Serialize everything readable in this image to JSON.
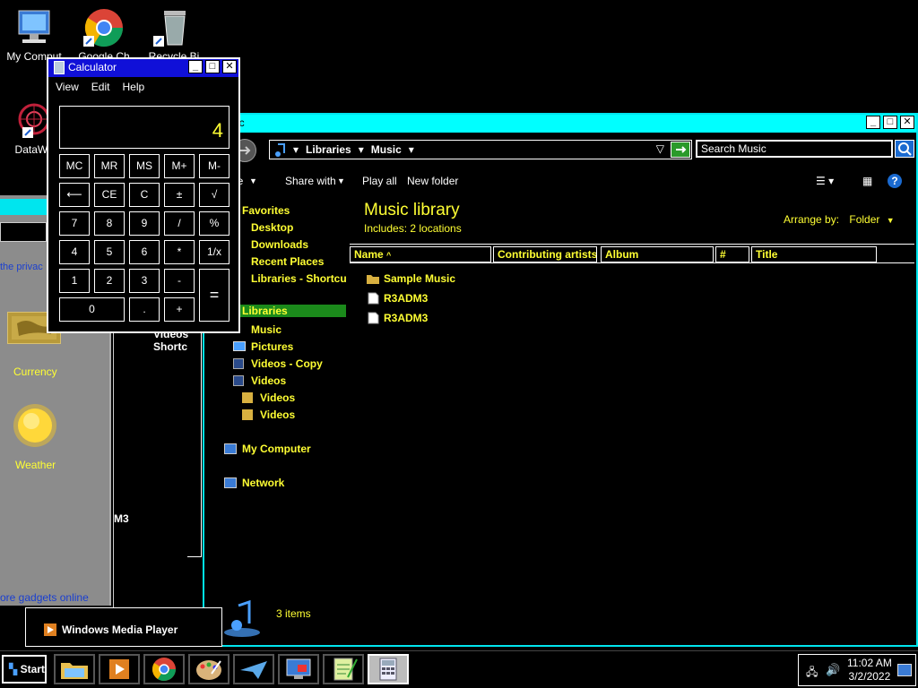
{
  "desktop": {
    "icons": [
      {
        "label": "My Comput"
      },
      {
        "label": "Google Ch"
      },
      {
        "label": "Recycle Bi"
      },
      {
        "label": "DataWa"
      }
    ],
    "truncated_labels": {
      "videos": "Videos",
      "shortcut": "Shortc",
      "m3": "M3"
    }
  },
  "gadgets": {
    "privacy_text": "the privac",
    "currency_label": "Currency",
    "weather_label": "Weather",
    "more_link": "ore gadgets online"
  },
  "explorer": {
    "title": "sic",
    "breadcrumb": [
      "Libraries",
      "Music"
    ],
    "search_placeholder": "Search Music",
    "toolbar": {
      "organize": "ize",
      "share": "Share with",
      "play_all": "Play all",
      "new_folder": "New folder"
    },
    "nav": {
      "favorites": "Favorites",
      "desktop": "Desktop",
      "downloads": "Downloads",
      "recent": "Recent Places",
      "lib_shortcut": "Libraries - Shortcut",
      "libraries": "Libraries",
      "music": "Music",
      "pictures": "Pictures",
      "videos_copy": "Videos - Copy",
      "videos": "Videos",
      "videos_sub1": "Videos",
      "videos_sub2": "Videos",
      "my_computer": "My Computer",
      "network": "Network"
    },
    "library_title": "Music library",
    "includes": "Includes:  2 locations",
    "arrange_label": "Arrange by:",
    "arrange_value": "Folder",
    "columns": [
      "Name",
      "Contributing artists",
      "Album",
      "#",
      "Title"
    ],
    "files": [
      {
        "name": "Sample Music",
        "type": "folder"
      },
      {
        "name": "R3ADM3",
        "type": "file"
      },
      {
        "name": "R3ADM3",
        "type": "file"
      }
    ],
    "status": "3 items"
  },
  "calculator": {
    "title": "Calculator",
    "menu": [
      "View",
      "Edit",
      "Help"
    ],
    "display": "4",
    "keys": {
      "mc": "MC",
      "mr": "MR",
      "ms": "MS",
      "mplus": "M+",
      "mminus": "M-",
      "back": "⟵",
      "ce": "CE",
      "c": "C",
      "pm": "±",
      "sqrt": "√",
      "k7": "7",
      "k8": "8",
      "k9": "9",
      "div": "/",
      "pct": "%",
      "k4": "4",
      "k5": "5",
      "k6": "6",
      "mul": "*",
      "recip": "1/x",
      "k1": "1",
      "k2": "2",
      "k3": "3",
      "sub": "-",
      "eq": "=",
      "k0": "0",
      "dot": ".",
      "add": "+"
    }
  },
  "tooltip": {
    "text": "Windows Media Player"
  },
  "taskbar": {
    "start": "Start",
    "time": "11:02 AM",
    "date": "3/2/2022"
  }
}
